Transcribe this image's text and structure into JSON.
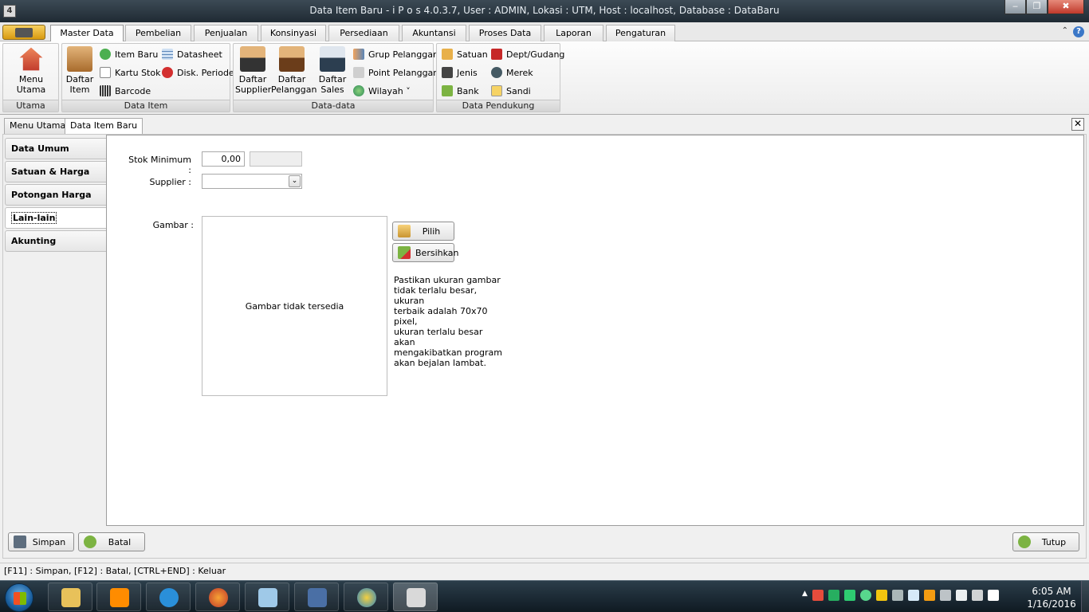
{
  "window": {
    "title": "Data Item Baru - i P o s 4.0.3.7,  User : ADMIN, Lokasi : UTM, Host : localhost, Database : DataBaru",
    "app_icon_text": "4",
    "minimize": "‒",
    "maximize": "❐",
    "close": "✖"
  },
  "ribbon_tabs": [
    "Master Data",
    "Pembelian",
    "Penjualan",
    "Konsinyasi",
    "Persediaan",
    "Akuntansi",
    "Proses Data",
    "Laporan",
    "Pengaturan"
  ],
  "ribbon_help": "?",
  "ribbon_collapse": "⌃",
  "ribbon": {
    "groups": [
      "Utama",
      "Data Item",
      "Data-data",
      "Data Pendukung"
    ],
    "menu_utama": "Menu Utama",
    "daftar_item": "Daftar\nItem",
    "item_baru": "Item Baru",
    "kartu_stok": "Kartu Stok",
    "barcode": "Barcode",
    "datasheet": "Datasheet",
    "disk_periode": "Disk. Periode",
    "daftar_supplier": "Daftar\nSupplier",
    "daftar_pelanggan": "Daftar\nPelanggan",
    "daftar_sales": "Daftar\nSales",
    "grup_pelanggan": "Grup Pelanggan",
    "point_pelanggan": "Point Pelanggan",
    "wilayah": "Wilayah ˅",
    "satuan": "Satuan",
    "jenis": "Jenis",
    "bank": "Bank",
    "dept_gudang": "Dept/Gudang",
    "merek": "Merek",
    "sandi": "Sandi"
  },
  "doc_tabs": [
    "Menu Utama",
    "Data Item Baru"
  ],
  "doc_close": "✕",
  "side_tabs": [
    "Data Umum",
    "Satuan & Harga Jual",
    "Potongan Harga Jual",
    "Lain-lain",
    "Akunting"
  ],
  "form": {
    "stok_minimum_label": "Stok Minimum :",
    "stok_minimum_value": "0,00",
    "stok_minimum_unit": "",
    "supplier_label": "Supplier :",
    "supplier_value": "",
    "combo_arrow": "⌄",
    "gambar_label": "Gambar :",
    "gambar_placeholder": "Gambar tidak tersedia",
    "pilih_button": "Pilih",
    "bersihkan_button": "Bersihkan",
    "note": "Pastikan ukuran gambar\ntidak terlalu besar, ukuran\nterbaik adalah 70x70 pixel,\nukuran terlalu besar akan\nmengakibatkan program\nakan bejalan lambat."
  },
  "buttons": {
    "simpan": "Simpan",
    "batal": "Batal",
    "tutup": "Tutup"
  },
  "statusbar": "[F11] : Simpan, [F12] : Batal, [CTRL+END] : Keluar",
  "taskbar": {
    "time": "6:05 AM",
    "date": "1/16/2016",
    "tray_arrow": "▲"
  },
  "colors": {
    "title_bar": "#1f2a33",
    "ribbon_accent": "#d89a10",
    "taskbar": "#0f1a22"
  }
}
